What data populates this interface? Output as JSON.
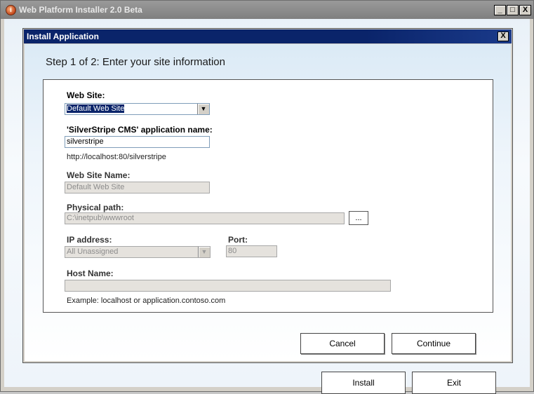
{
  "outer_window": {
    "title": "Web Platform Installer 2.0 Beta",
    "icon": "web-platform-installer-icon",
    "controls": {
      "minimize": "_",
      "maximize": "□",
      "close": "X"
    },
    "behind_buttons": {
      "install": "Install",
      "exit": "Exit"
    }
  },
  "dialog": {
    "title": "Install Application",
    "close_glyph": "X",
    "step_heading": "Step 1 of 2: Enter your site information",
    "fields": {
      "web_site": {
        "label": "Web Site:",
        "value": "Default Web Site"
      },
      "app_name": {
        "label": "'SilverStripe CMS' application name:",
        "value": "silverstripe",
        "url_hint": "http://localhost:80/silverstripe"
      },
      "site_name": {
        "label": "Web Site Name:",
        "value": "Default Web Site"
      },
      "physical_path": {
        "label": "Physical path:",
        "value": "C:\\inetpub\\wwwroot",
        "browse": "..."
      },
      "ip_address": {
        "label": "IP address:",
        "value": "All Unassigned"
      },
      "port": {
        "label": "Port:",
        "value": "80"
      },
      "host_name": {
        "label": "Host Name:",
        "value": "",
        "example": "Example: localhost or application.contoso.com"
      }
    },
    "buttons": {
      "cancel": "Cancel",
      "continue": "Continue"
    }
  }
}
